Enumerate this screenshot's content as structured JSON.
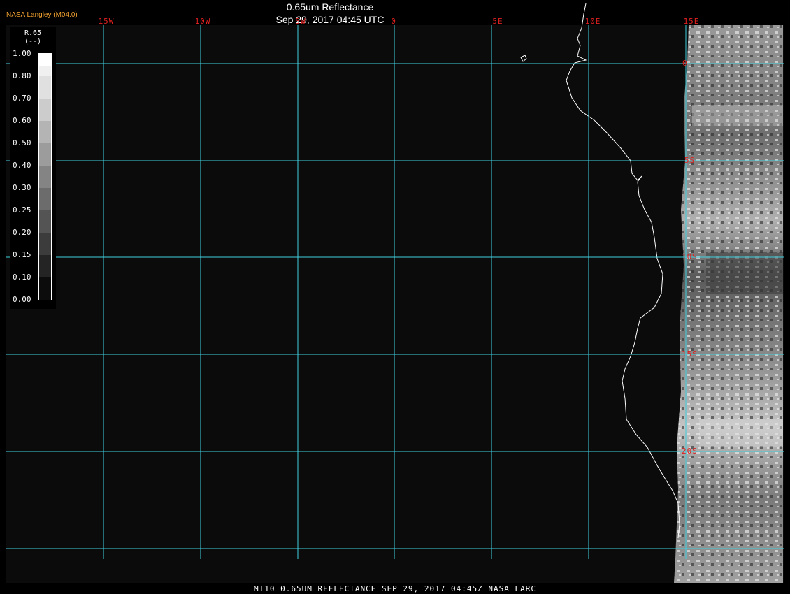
{
  "header": {
    "brand": "NASA Langley (M04.0)",
    "title": "0.65um Reflectance",
    "datetime": "Sep 29, 2017 04:45 UTC"
  },
  "longitude_labels": [
    "15W",
    "10W",
    "5W",
    "0",
    "5E",
    "10E",
    "15E"
  ],
  "latitude_labels": [
    "0",
    "5S",
    "10S",
    "15S",
    "20S"
  ],
  "colorbar": {
    "name": "R.65",
    "units": "(--)",
    "ticks": [
      "1.00",
      "0.80",
      "0.70",
      "0.60",
      "0.50",
      "0.40",
      "0.30",
      "0.25",
      "0.20",
      "0.15",
      "0.10",
      "0.00"
    ]
  },
  "footer": "MT10  0.65UM REFLECTANCE   SEP 29, 2017 04:45Z   NASA LARC",
  "colors": {
    "grid": "#40d0e0",
    "labels": "#e02020",
    "brand": "#f0a030",
    "coast": "#ffffff"
  }
}
